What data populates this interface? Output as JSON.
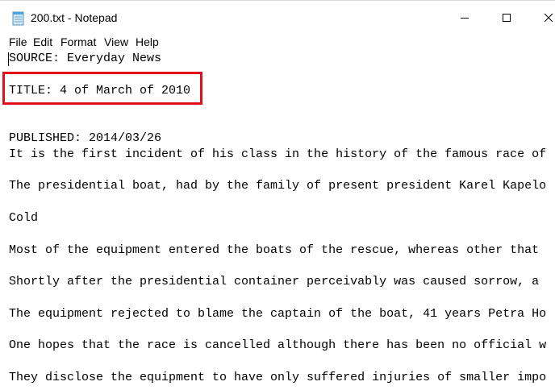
{
  "window": {
    "title": "200.txt - Notepad",
    "icon": "notepad-icon",
    "controls": {
      "minimize": "minimize-icon",
      "maximize": "maximize-icon",
      "close": "close-icon"
    }
  },
  "menu": {
    "file": "File",
    "edit": "Edit",
    "format": "Format",
    "view": "View",
    "help": "Help"
  },
  "editor": {
    "lines": [
      "SOURCE: Everyday News",
      "",
      "TITLE: 4 of March of 2010",
      "",
      "",
      "PUBLISHED: 2014/03/26",
      "It is the first incident of his class in the history of the famous race of",
      "",
      "The presidential boat, had by the family of present president Karel Kapelo",
      "",
      "Cold",
      "",
      "Most of the equipment entered the boats of the rescue, whereas other that",
      "",
      "Shortly after the presidential container perceivably was caused sorrow, a",
      "",
      "The equipment rejected to blame the captain of the boat, 41 years Petra Ho",
      "",
      "One hopes that the race is cancelled although there has been no official w",
      "",
      "They disclose the equipment to have only suffered injuries of smaller impo"
    ]
  },
  "colors": {
    "highlight_border": "#e0111a",
    "background": "#ffffff",
    "text": "#000000"
  }
}
